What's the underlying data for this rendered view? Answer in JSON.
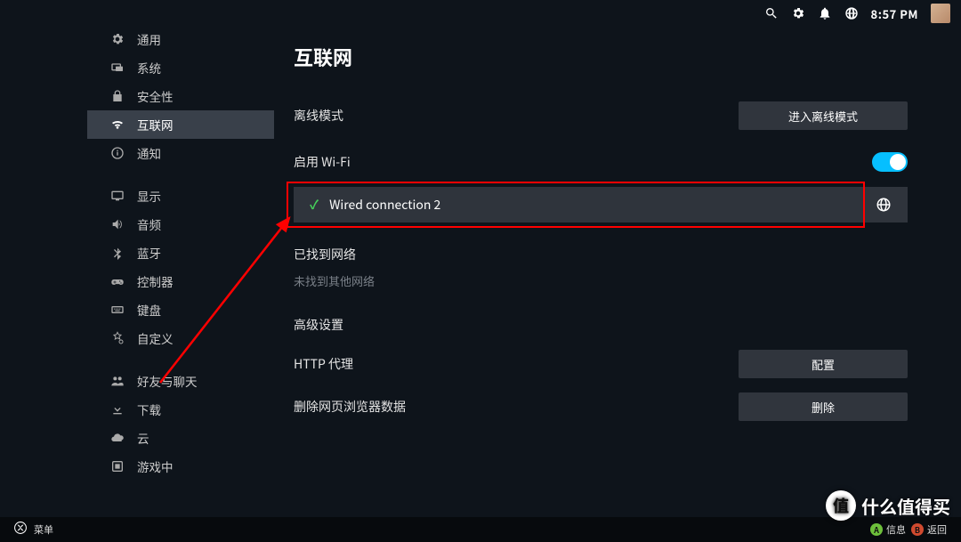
{
  "topbar": {
    "time": "8:57 PM"
  },
  "sidebar": {
    "items": [
      {
        "label": "通用",
        "icon": "gear-icon"
      },
      {
        "label": "系统",
        "icon": "system-icon"
      },
      {
        "label": "安全性",
        "icon": "lock-icon"
      },
      {
        "label": "互联网",
        "icon": "wifi-icon",
        "selected": true
      },
      {
        "label": "通知",
        "icon": "info-icon"
      }
    ],
    "items2": [
      {
        "label": "显示",
        "icon": "display-icon"
      },
      {
        "label": "音频",
        "icon": "audio-icon"
      },
      {
        "label": "蓝牙",
        "icon": "bluetooth-icon"
      },
      {
        "label": "控制器",
        "icon": "controller-icon"
      },
      {
        "label": "键盘",
        "icon": "keyboard-icon"
      },
      {
        "label": "自定义",
        "icon": "customize-icon"
      }
    ],
    "items3": [
      {
        "label": "好友与聊天",
        "icon": "friends-icon"
      },
      {
        "label": "下载",
        "icon": "download-icon"
      },
      {
        "label": "云",
        "icon": "cloud-icon"
      },
      {
        "label": "游戏中",
        "icon": "ingame-icon"
      }
    ]
  },
  "main": {
    "title": "互联网",
    "offline_label": "离线模式",
    "offline_btn": "进入离线模式",
    "wifi_label": "启用 Wi-Fi",
    "wifi_on": true,
    "connection": {
      "name": "Wired connection 2",
      "active": true
    },
    "found_label": "已找到网络",
    "no_other": "未找到其他网络",
    "advanced_label": "高级设置",
    "http_proxy_label": "HTTP 代理",
    "http_proxy_btn": "配置",
    "clear_browser_label": "删除网页浏览器数据",
    "clear_browser_btn": "删除"
  },
  "bottombar": {
    "menu": "菜单",
    "hint_a": "信息",
    "hint_b": "返回"
  },
  "watermark": {
    "badge": "值",
    "text": "什么值得买"
  }
}
